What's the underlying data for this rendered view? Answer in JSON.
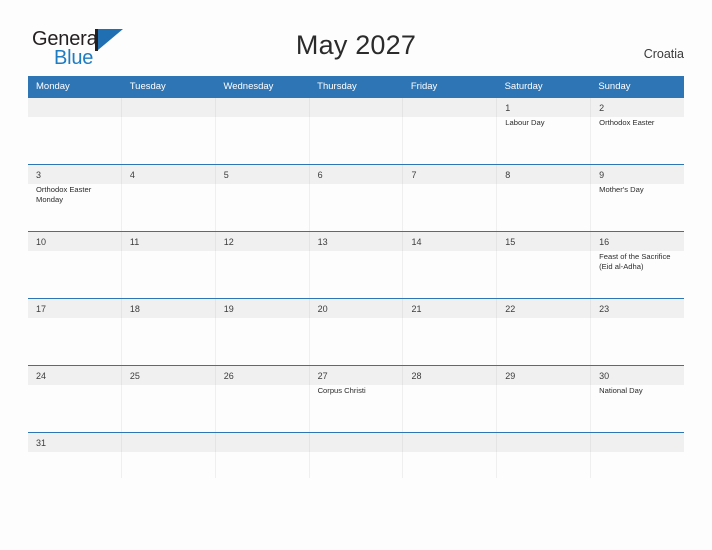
{
  "brand": {
    "name_part1": "General",
    "name_part2": "Blue",
    "logo_icon": "triangle-flag-icon"
  },
  "header": {
    "title": "May 2027",
    "country": "Croatia"
  },
  "calendar": {
    "weekday_headers": [
      "Monday",
      "Tuesday",
      "Wednesday",
      "Thursday",
      "Friday",
      "Saturday",
      "Sunday"
    ],
    "accent_color": "#2E75B6",
    "strip_color": "#F0F0F0",
    "weeks": [
      {
        "days": [
          {
            "num": "",
            "event": ""
          },
          {
            "num": "",
            "event": ""
          },
          {
            "num": "",
            "event": ""
          },
          {
            "num": "",
            "event": ""
          },
          {
            "num": "",
            "event": ""
          },
          {
            "num": "1",
            "event": "Labour Day"
          },
          {
            "num": "2",
            "event": "Orthodox Easter"
          }
        ]
      },
      {
        "days": [
          {
            "num": "3",
            "event": "Orthodox Easter Monday"
          },
          {
            "num": "4",
            "event": ""
          },
          {
            "num": "5",
            "event": ""
          },
          {
            "num": "6",
            "event": ""
          },
          {
            "num": "7",
            "event": ""
          },
          {
            "num": "8",
            "event": ""
          },
          {
            "num": "9",
            "event": "Mother's Day"
          }
        ]
      },
      {
        "days": [
          {
            "num": "10",
            "event": ""
          },
          {
            "num": "11",
            "event": ""
          },
          {
            "num": "12",
            "event": ""
          },
          {
            "num": "13",
            "event": ""
          },
          {
            "num": "14",
            "event": ""
          },
          {
            "num": "15",
            "event": ""
          },
          {
            "num": "16",
            "event": "Feast of the Sacrifice (Eid al-Adha)"
          }
        ]
      },
      {
        "days": [
          {
            "num": "17",
            "event": ""
          },
          {
            "num": "18",
            "event": ""
          },
          {
            "num": "19",
            "event": ""
          },
          {
            "num": "20",
            "event": ""
          },
          {
            "num": "21",
            "event": ""
          },
          {
            "num": "22",
            "event": ""
          },
          {
            "num": "23",
            "event": ""
          }
        ]
      },
      {
        "days": [
          {
            "num": "24",
            "event": ""
          },
          {
            "num": "25",
            "event": ""
          },
          {
            "num": "26",
            "event": ""
          },
          {
            "num": "27",
            "event": "Corpus Christi"
          },
          {
            "num": "28",
            "event": ""
          },
          {
            "num": "29",
            "event": ""
          },
          {
            "num": "30",
            "event": "National Day"
          }
        ]
      },
      {
        "short": true,
        "days": [
          {
            "num": "31",
            "event": ""
          },
          {
            "num": "",
            "event": ""
          },
          {
            "num": "",
            "event": ""
          },
          {
            "num": "",
            "event": ""
          },
          {
            "num": "",
            "event": ""
          },
          {
            "num": "",
            "event": ""
          },
          {
            "num": "",
            "event": ""
          }
        ]
      }
    ]
  }
}
